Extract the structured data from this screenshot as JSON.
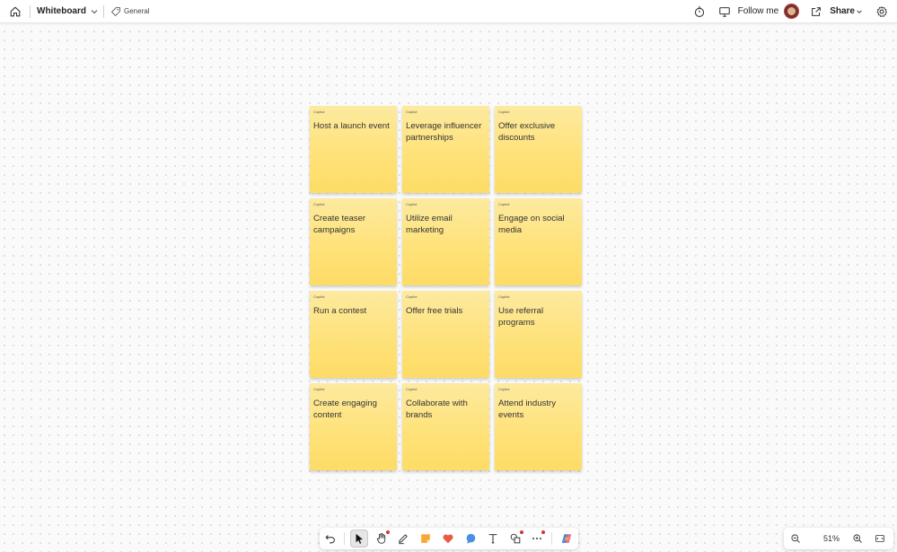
{
  "header": {
    "app_title": "Whiteboard",
    "tag_label": "General",
    "follow_label": "Follow me",
    "share_label": "Share"
  },
  "notes": [
    {
      "author": "Copilot",
      "text": "Host a launch event"
    },
    {
      "author": "Copilot",
      "text": "Leverage influencer partnerships"
    },
    {
      "author": "Copilot",
      "text": "Offer exclusive discounts"
    },
    {
      "author": "Copilot",
      "text": "Create teaser campaigns"
    },
    {
      "author": "Copilot",
      "text": "Utilize email marketing"
    },
    {
      "author": "Copilot",
      "text": "Engage on social media"
    },
    {
      "author": "Copilot",
      "text": "Run a contest"
    },
    {
      "author": "Copilot",
      "text": "Offer free trials"
    },
    {
      "author": "Copilot",
      "text": "Use referral programs"
    },
    {
      "author": "Copilot",
      "text": "Create engaging content"
    },
    {
      "author": "Copilot",
      "text": "Collaborate with brands"
    },
    {
      "author": "Copilot",
      "text": "Attend industry events"
    }
  ],
  "toolbar": {
    "tools": [
      "undo-icon",
      "select-pointer-icon",
      "hand-pan-icon",
      "pen-icon",
      "sticky-note-icon",
      "reaction-heart-icon",
      "comment-icon",
      "text-icon",
      "shapes-icon",
      "more-icon",
      "copilot-icon"
    ],
    "active_tool": "select-pointer-icon"
  },
  "zoom": {
    "level": "51%"
  },
  "colors": {
    "note_yellow": "#fee27a",
    "accent_red": "#d13438"
  }
}
